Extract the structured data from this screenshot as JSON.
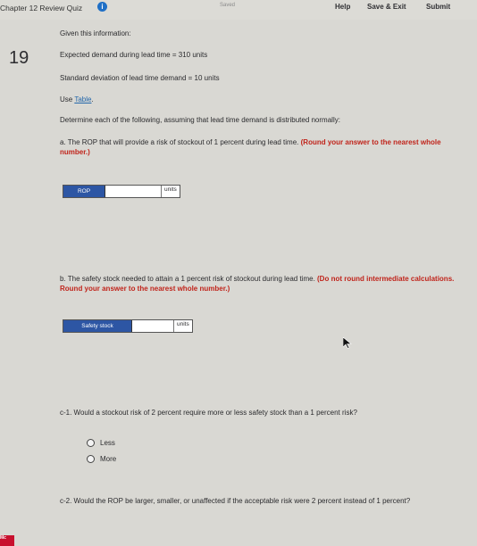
{
  "header": {
    "title": "Chapter 12 Review Quiz",
    "saved": "Saved",
    "help": "Help",
    "save_exit": "Save & Exit",
    "submit": "Submit"
  },
  "question_number": "19",
  "intro": "Given this information:",
  "given": {
    "demand": "Expected demand during lead time = 310 units",
    "stdev": "Standard deviation of lead time demand = 10 units",
    "use_prefix": "Use ",
    "use_link": "Table",
    "use_suffix": "."
  },
  "instruction": "Determine each of the following, assuming that lead time demand is distributed normally:",
  "part_a": {
    "text": "a. The ROP that will provide a risk of stockout of 1 percent during lead time. ",
    "emph": "(Round your answer to the nearest whole number.)",
    "label": "ROP",
    "unit": "units",
    "value": ""
  },
  "part_b": {
    "text": "b. The safety stock needed to attain a 1 percent risk of stockout during lead time. ",
    "emph": "(Do not round intermediate calculations. Round your answer to the nearest whole number.)",
    "label": "Safety stock",
    "unit": "units",
    "value": ""
  },
  "part_c1": {
    "text": "c-1. Would a stockout risk of 2 percent require more or less safety stock than a 1 percent risk?",
    "options": [
      "Less",
      "More"
    ]
  },
  "part_c2": {
    "text": "c-2. Would the ROP be larger, smaller, or unaffected if the acceptable risk were 2 percent instead of 1 percent?"
  },
  "logo": "Mc"
}
